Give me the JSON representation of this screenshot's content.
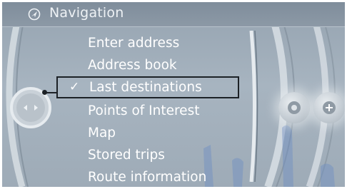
{
  "header": {
    "title": "Navigation",
    "icon": "navigation-icon"
  },
  "menu": {
    "items": [
      {
        "label": "Enter address"
      },
      {
        "label": "Address book"
      },
      {
        "label": "Last destinations",
        "selected": true
      },
      {
        "label": "Points of Interest"
      },
      {
        "label": "Map"
      },
      {
        "label": "Stored trips"
      },
      {
        "label": "Route information"
      }
    ]
  },
  "controls": {
    "left_knob_icon": "controller-arrows-icon",
    "settings_icon": "settings-icon",
    "plus_icon": "plus-icon"
  },
  "colors": {
    "screen_background": "#a7b4c0",
    "text": "#ffffff",
    "selection_border": "#1c2126"
  }
}
